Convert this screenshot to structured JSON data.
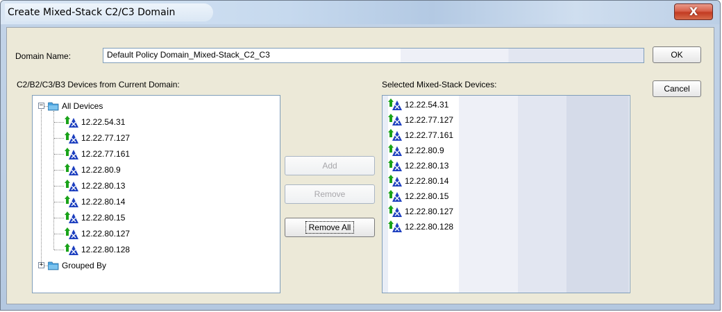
{
  "window": {
    "title": "Create Mixed-Stack C2/C3 Domain",
    "close_glyph": "X"
  },
  "domain_name": {
    "label": "Domain Name:",
    "value": "Default Policy Domain_Mixed-Stack_C2_C3"
  },
  "buttons": {
    "ok": "OK",
    "cancel": "Cancel",
    "add": "Add",
    "remove": "Remove",
    "remove_all": "Remove All"
  },
  "left_panel": {
    "header": "C2/B2/C3/B3 Devices from Current Domain:",
    "root_label": "All Devices",
    "devices": [
      "12.22.54.31",
      "12.22.77.127",
      "12.22.77.161",
      "12.22.80.9",
      "12.22.80.13",
      "12.22.80.14",
      "12.22.80.15",
      "12.22.80.127",
      "12.22.80.128"
    ],
    "grouped_label": "Grouped By"
  },
  "right_panel": {
    "header": "Selected Mixed-Stack Devices:",
    "devices": [
      "12.22.54.31",
      "12.22.77.127",
      "12.22.77.161",
      "12.22.80.9",
      "12.22.80.13",
      "12.22.80.14",
      "12.22.80.15",
      "12.22.80.127",
      "12.22.80.128"
    ]
  },
  "icons": {
    "device": "switch-device-icon",
    "folder": "folder-icon",
    "expand": "plus-icon",
    "collapse": "minus-icon",
    "close": "close-icon"
  },
  "colors": {
    "device_green": "#1aa31a",
    "device_blue": "#1d3fbf",
    "folder_blue": "#4aa3df"
  }
}
